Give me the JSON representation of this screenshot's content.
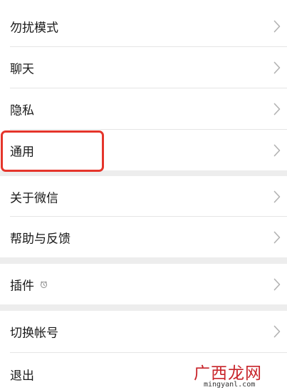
{
  "settings": {
    "groups": [
      {
        "items": [
          {
            "label": "勿扰模式"
          },
          {
            "label": "聊天"
          },
          {
            "label": "隐私"
          },
          {
            "label": "通用"
          }
        ]
      },
      {
        "items": [
          {
            "label": "关于微信"
          },
          {
            "label": "帮助与反馈"
          }
        ]
      },
      {
        "items": [
          {
            "label": "插件",
            "icon": "plugin-badge-icon"
          }
        ]
      },
      {
        "items": [
          {
            "label": "切换帐号"
          },
          {
            "label": "退出"
          }
        ]
      }
    ]
  },
  "annotation": {
    "color": "#e5352b"
  },
  "watermark": {
    "title": "广西龙网",
    "url": "mingyanl.com"
  },
  "colors": {
    "background": "#ededed",
    "row": "#ffffff",
    "text": "#191919",
    "chevron": "#b2b2b2"
  }
}
